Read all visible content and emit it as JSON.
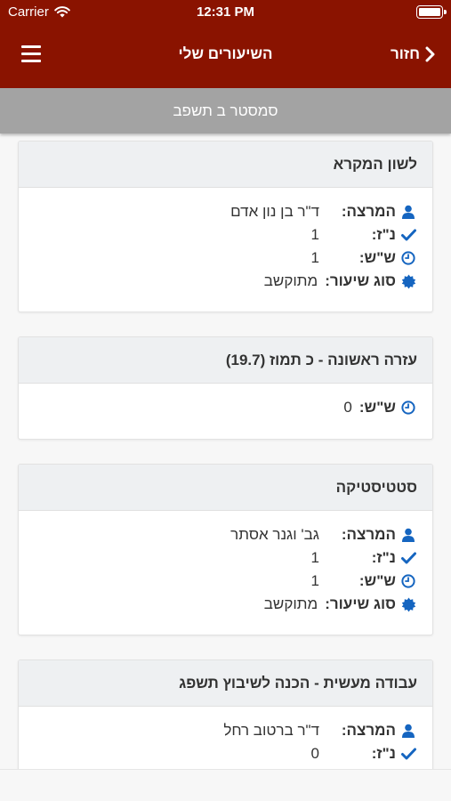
{
  "status": {
    "carrier": "Carrier",
    "time": "12:31 PM"
  },
  "nav": {
    "title": "השיעורים שלי",
    "back": "חזור"
  },
  "semester": "סמסטר ב תשפב",
  "labels": {
    "lecturer": "המרצה:",
    "credits": "נ\"ז:",
    "hours": "ש\"ש:",
    "type": "סוג שיעור:"
  },
  "courses": [
    {
      "title": "לשון המקרא",
      "lecturer": "ד\"ר בן נון אדם",
      "credits": "1",
      "hours": "1",
      "type": "מתוקשב"
    },
    {
      "title": "עזרה ראשונה - כ תמוז (19.7)",
      "hours": "0"
    },
    {
      "title": "סטטיסטיקה",
      "lecturer": "גב' וגנר אסתר",
      "credits": "1",
      "hours": "1",
      "type": "מתוקשב"
    },
    {
      "title": "עבודה מעשית - הכנה לשיבוץ תשפג",
      "lecturer": "ד\"ר ברטוב רחל",
      "credits": "0"
    }
  ],
  "colors": {
    "header": "#8a1300",
    "semester_bar": "#a3a3a3",
    "icon": "#1565c0"
  },
  "icons": {
    "lecturer": "user-icon",
    "credits": "check-icon",
    "hours": "clock-icon",
    "type": "badge-icon"
  }
}
